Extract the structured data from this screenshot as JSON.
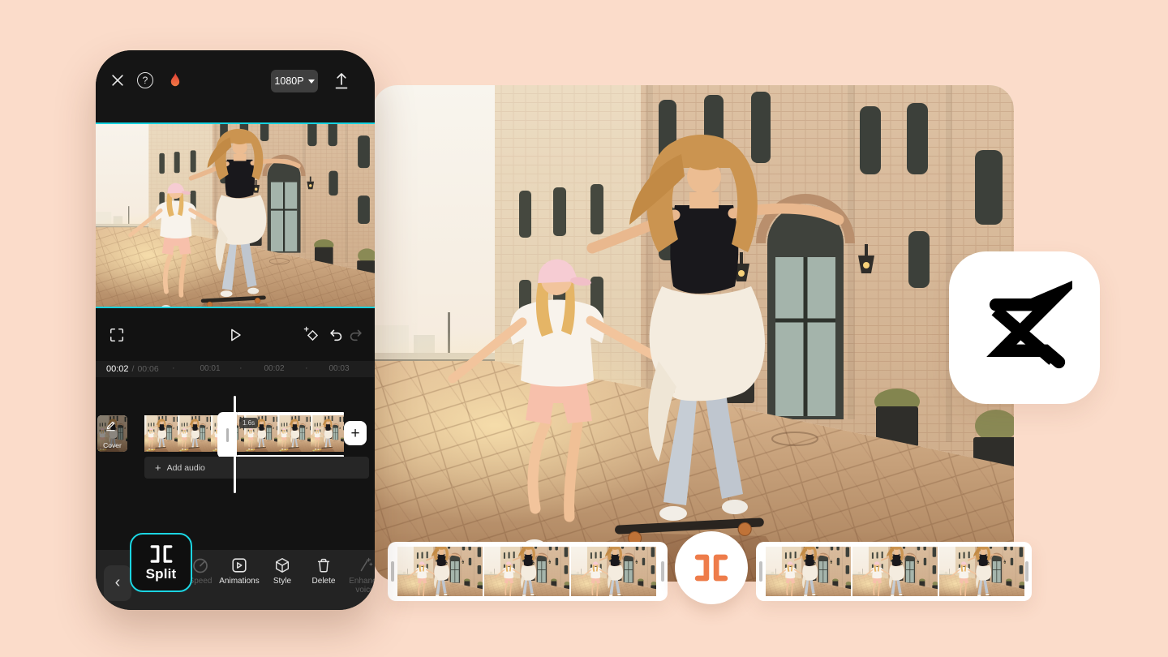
{
  "page": {
    "bg": "#FBDCCA"
  },
  "phone": {
    "header": {
      "help_glyph": "?",
      "resolution_label": "1080P"
    },
    "transport": {
      "current_time": "00:02",
      "separator": "/",
      "total_time": "00:06",
      "tick_dot": "·",
      "ticks": [
        "00:01",
        "00:02",
        "00:03"
      ]
    },
    "timeline": {
      "cover_label": "Cover",
      "clip_duration": "1.6s",
      "add_clip_glyph": "+",
      "add_audio_plus": "+",
      "add_audio_label": "Add audio",
      "playhead_color": "#FFFFFF"
    },
    "toolbar": {
      "back_glyph": "‹",
      "items": [
        {
          "label": "Split",
          "state": "selected"
        },
        {
          "label": "Speed",
          "state": "dimmed"
        },
        {
          "label": "Animations",
          "state": "normal"
        },
        {
          "label": "Style",
          "state": "normal"
        },
        {
          "label": "Delete",
          "state": "normal"
        },
        {
          "label": "Enhance voice",
          "state": "dimmed"
        }
      ]
    }
  },
  "filmstrip": {
    "left_thumb_count": 3,
    "right_thumb_count": 3
  },
  "colors": {
    "page_bg": "#FBDCCA",
    "accent_cyan": "#1BD5E2",
    "accent_orange": "#EE7C4A",
    "flame_red": "#E8463C",
    "phone_bg": "#111111",
    "toolbar_bg": "#232323",
    "tile_bg": "#FFFFFF"
  }
}
